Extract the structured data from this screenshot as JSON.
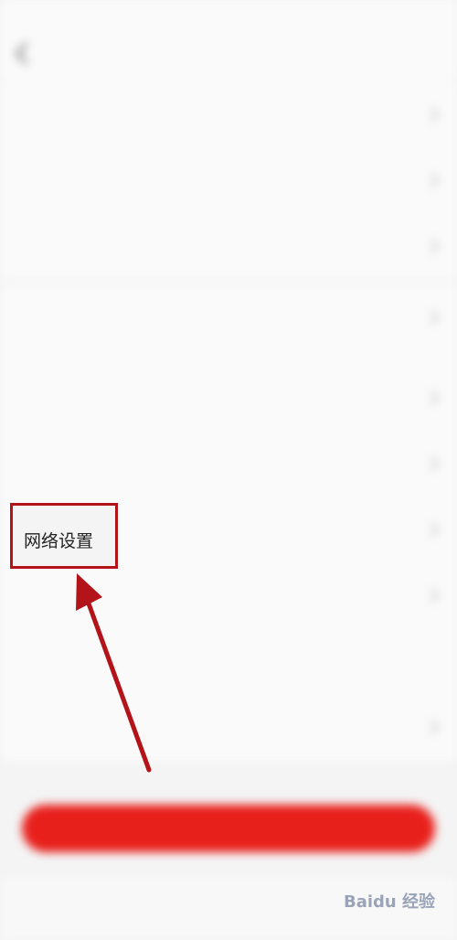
{
  "highlighted_item": {
    "label": "网络设置"
  },
  "watermark": "Baidu 经验",
  "colors": {
    "accent_red": "#e8201c",
    "annotation": "#b3141a"
  }
}
